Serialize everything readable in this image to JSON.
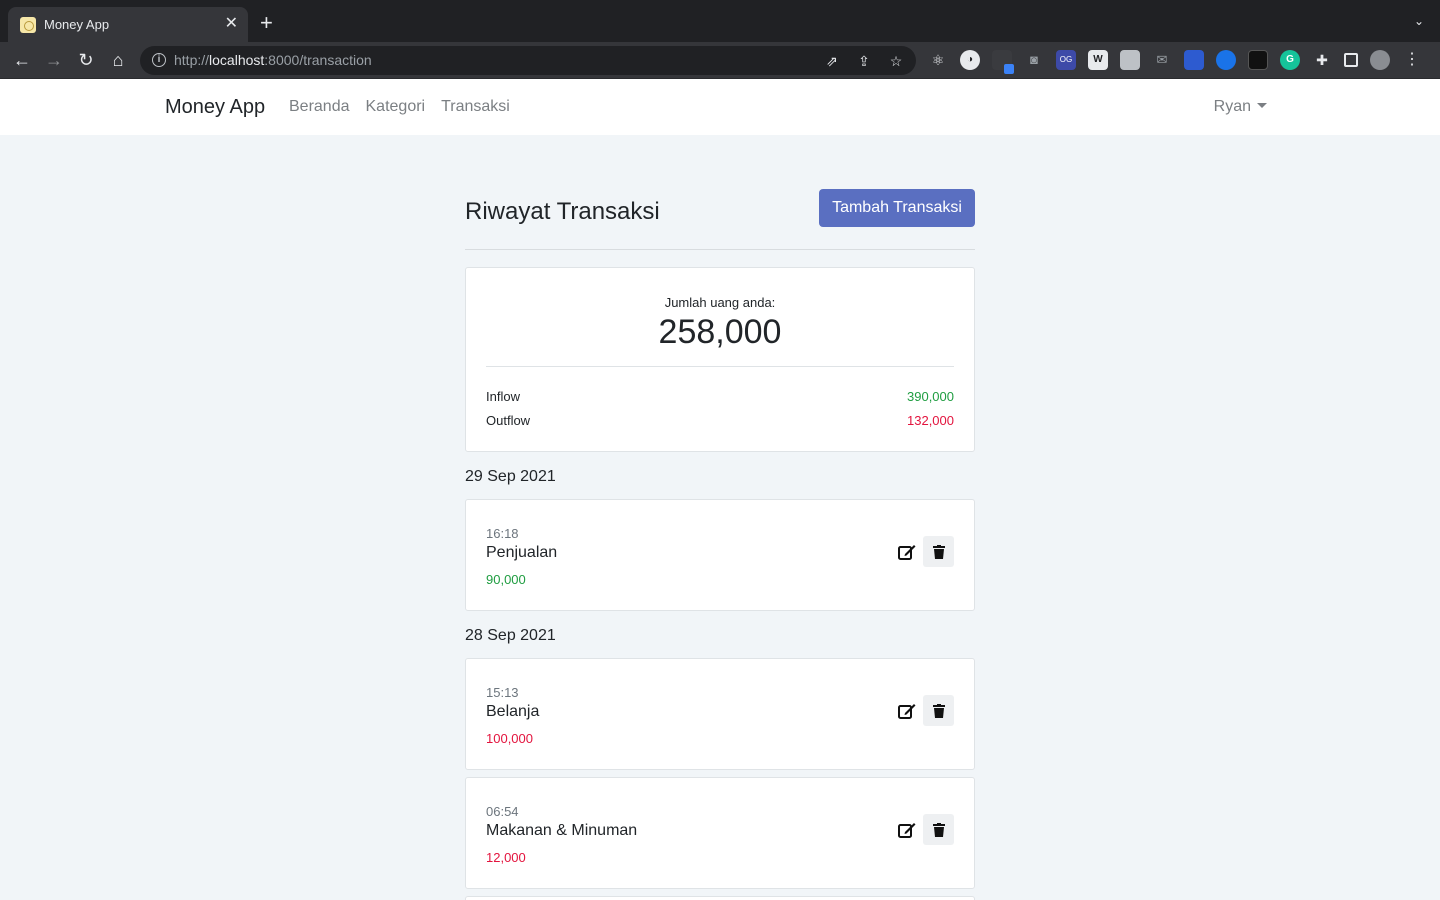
{
  "browser": {
    "tab_title": "Money App",
    "url_scheme": "http://",
    "url_host": "localhost",
    "url_path": ":8000/transaction"
  },
  "navbar": {
    "brand": "Money App",
    "links": [
      "Beranda",
      "Kategori",
      "Transaksi"
    ],
    "user": "Ryan"
  },
  "page": {
    "title": "Riwayat Transaksi",
    "add_button": "Tambah Transaksi"
  },
  "summary": {
    "label": "Jumlah uang anda:",
    "total": "258,000",
    "inflow_label": "Inflow",
    "inflow_value": "390,000",
    "outflow_label": "Outflow",
    "outflow_value": "132,000"
  },
  "groups": [
    {
      "date": "29 Sep 2021",
      "items": [
        {
          "time": "16:18",
          "name": "Penjualan",
          "amount": "90,000",
          "type": "income"
        }
      ]
    },
    {
      "date": "28 Sep 2021",
      "items": [
        {
          "time": "15:13",
          "name": "Belanja",
          "amount": "100,000",
          "type": "expense"
        },
        {
          "time": "06:54",
          "name": "Makanan & Minuman",
          "amount": "12,000",
          "type": "expense"
        }
      ]
    }
  ],
  "colors": {
    "accent": "#5a6fc1",
    "income": "#1f9d41",
    "expense": "#e3143e",
    "page_bg": "#f1f5f8"
  },
  "icons": {
    "edit": "edit-icon",
    "delete": "trash-icon"
  }
}
